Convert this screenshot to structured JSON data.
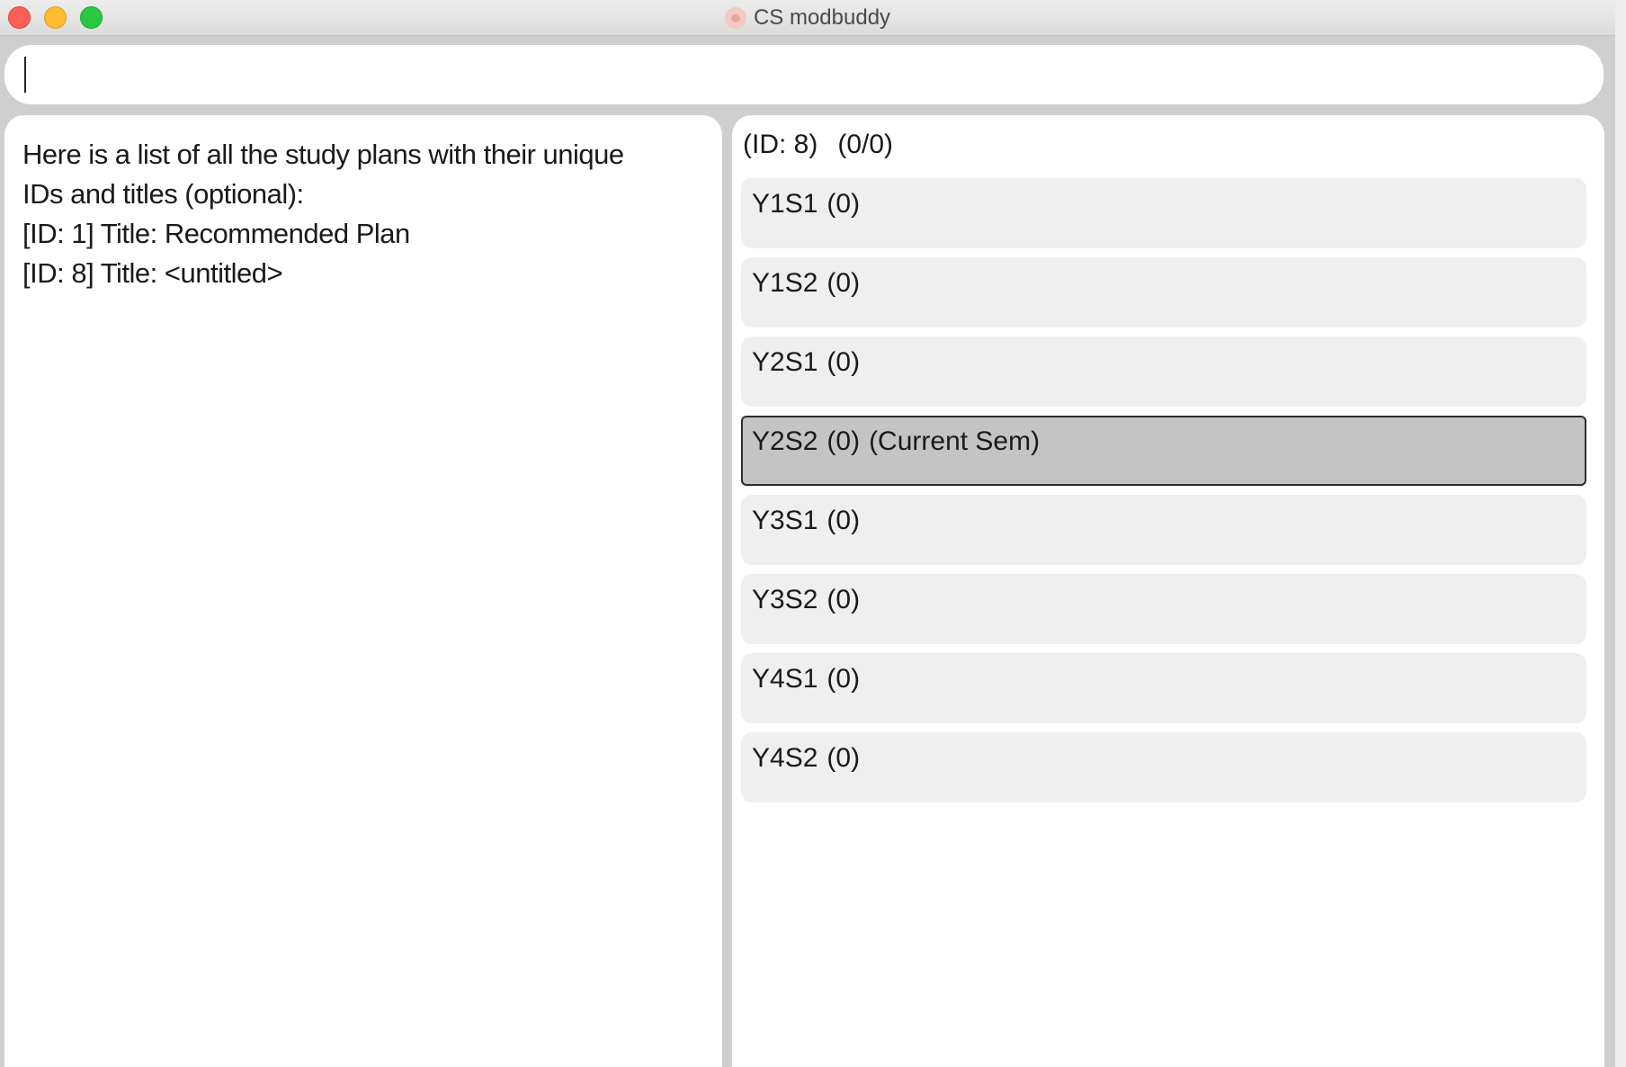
{
  "window": {
    "title": "CS modbuddy"
  },
  "command": {
    "value": ""
  },
  "result": {
    "lines": [
      "Here is a list of all the study plans with their unique",
      "IDs and titles (optional):",
      "[ID: 1] Title: Recommended Plan",
      "[ID: 8] Title: <untitled>"
    ]
  },
  "plan": {
    "id_label": "(ID: 8)",
    "mc_label": "(0/0)",
    "semesters": [
      {
        "name": "Y1S1",
        "count": "(0)",
        "note": ""
      },
      {
        "name": "Y1S2",
        "count": "(0)",
        "note": ""
      },
      {
        "name": "Y2S1",
        "count": "(0)",
        "note": ""
      },
      {
        "name": "Y2S2",
        "count": "(0)",
        "note": "(Current Sem)"
      },
      {
        "name": "Y3S1",
        "count": "(0)",
        "note": ""
      },
      {
        "name": "Y3S2",
        "count": "(0)",
        "note": ""
      },
      {
        "name": "Y4S1",
        "count": "(0)",
        "note": ""
      },
      {
        "name": "Y4S2",
        "count": "(0)",
        "note": ""
      }
    ]
  },
  "icons": {
    "close": "close-button",
    "minimize": "minimize-button",
    "maximize": "maximize-button",
    "app": "app-icon"
  }
}
